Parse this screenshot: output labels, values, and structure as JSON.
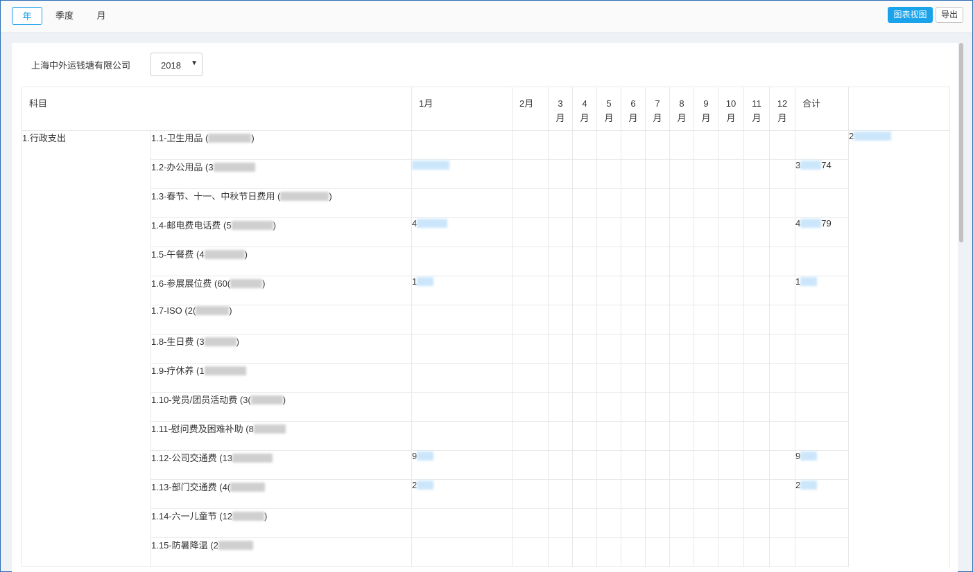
{
  "tabs": [
    {
      "label": "年",
      "active": true
    },
    {
      "label": "季度",
      "active": false
    },
    {
      "label": "月",
      "active": false
    }
  ],
  "toolbar": {
    "chart_view_label": "图表视图",
    "export_label": "导出"
  },
  "filter": {
    "company": "上海中外运钱塘有限公司",
    "year": "2018"
  },
  "table": {
    "headers": {
      "subject": "科目",
      "months": [
        "1月",
        "2月",
        "3\n月",
        "4\n月",
        "5\n月",
        "6\n月",
        "7\n月",
        "8\n月",
        "9\n月",
        "10\n月",
        "11\n月",
        "12\n月"
      ],
      "total": "合计"
    },
    "category": {
      "label": "1.行政支出",
      "total_prefix": "2"
    },
    "rows": [
      {
        "prefix": "1.1-卫生用品 (",
        "suffix": ")",
        "jan": "",
        "total": ""
      },
      {
        "prefix": "1.2-办公用品 (3",
        "suffix": "",
        "jan": "",
        "total_prefix": "3",
        "total_suffix": "74"
      },
      {
        "prefix": "1.3-春节、十一、中秋节日费用 (",
        "suffix": ")",
        "jan": "",
        "total": ""
      },
      {
        "prefix": "1.4-邮电费电话费 (5",
        "suffix": ")",
        "jan_prefix": "4",
        "total_prefix": "4",
        "total_suffix": "79"
      },
      {
        "prefix": "1.5-午餐费 (4",
        "suffix": ")",
        "jan": "",
        "total": ""
      },
      {
        "prefix": "1.6-参展展位费 (60(",
        "suffix": ")",
        "jan_prefix": "1",
        "total_prefix": "1"
      },
      {
        "prefix": "1.7-ISO (2(",
        "suffix": ")",
        "jan": "",
        "total": ""
      },
      {
        "prefix": "1.8-生日费 (3",
        "suffix": ")",
        "jan": "",
        "total": ""
      },
      {
        "prefix": "1.9-疗休养 (1",
        "suffix": "",
        "jan": "",
        "total": ""
      },
      {
        "prefix": "1.10-党员/团员活动费 (3(",
        "suffix": ")",
        "jan": "",
        "total": ""
      },
      {
        "prefix": "1.11-慰问费及困难补助 (8",
        "suffix": "",
        "jan": "",
        "total": ""
      },
      {
        "prefix": "1.12-公司交通费 (13",
        "suffix": "",
        "jan_prefix": "9",
        "total_prefix": "9"
      },
      {
        "prefix": "1.13-部门交通费 (4(",
        "suffix": "",
        "jan_prefix": "2",
        "total_prefix": "2"
      },
      {
        "prefix": "1.14-六一儿童节 (12",
        "suffix": ")",
        "jan": "",
        "total": ""
      },
      {
        "prefix": "1.15-防暑降温 (2",
        "suffix": "",
        "jan": "",
        "total": ""
      }
    ]
  }
}
